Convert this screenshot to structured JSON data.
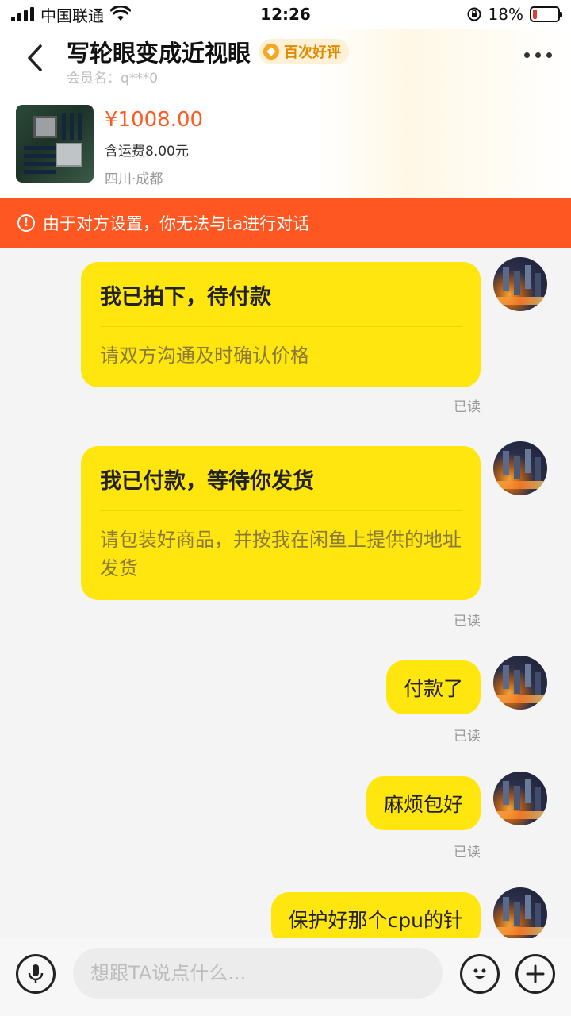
{
  "status_bar": {
    "carrier": "中国联通",
    "time": "12:26",
    "battery": "18%",
    "battery_level": 0.18
  },
  "header": {
    "title": "写轮眼变成近视眼",
    "badge": "百次好评",
    "member_label": "会员名：q***0"
  },
  "product": {
    "price": "¥1008.00",
    "shipping": "含运费8.00元",
    "location": "四川·成都"
  },
  "alert": {
    "text": "由于对方设置，你无法与ta进行对话"
  },
  "messages": [
    {
      "type": "card",
      "title": "我已拍下，待付款",
      "body": "请双方沟通及时确认价格",
      "status": "已读"
    },
    {
      "type": "card",
      "title": "我已付款，等待你发货",
      "body": "请包装好商品，并按我在闲鱼上提供的地址发货",
      "status": "已读"
    },
    {
      "type": "text",
      "text": "付款了",
      "status": "已读"
    },
    {
      "type": "text",
      "text": "麻烦包好",
      "status": "已读"
    },
    {
      "type": "text",
      "text": "保护好那个cpu的针"
    }
  ],
  "input": {
    "placeholder": "想跟TA说点什么..."
  },
  "icons": {
    "back": "chevron-left-icon",
    "more": "more-dots-icon",
    "alert": "exclamation-circle-icon",
    "voice": "microphone-icon",
    "emoji": "smiley-icon",
    "plus": "plus-icon"
  },
  "colors": {
    "accent_orange": "#ff5722",
    "price": "#ff5a20",
    "bubble_yellow": "#ffe60f"
  }
}
